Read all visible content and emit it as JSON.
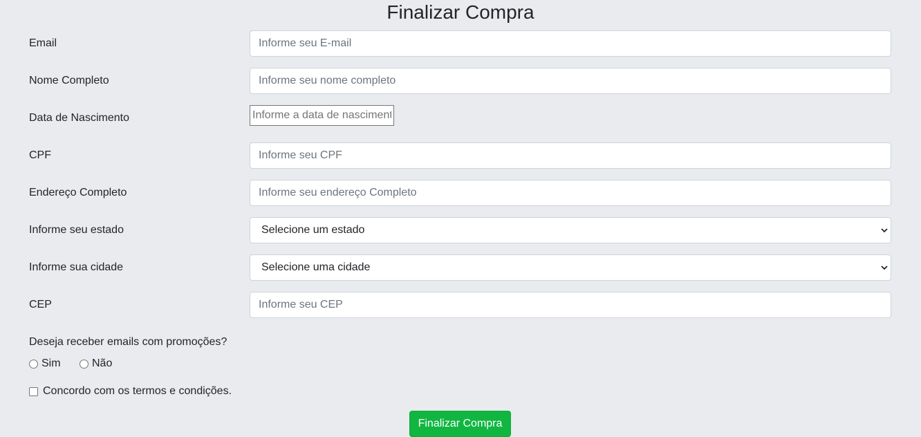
{
  "page": {
    "title": "Finalizar Compra"
  },
  "form": {
    "email": {
      "label": "Email",
      "placeholder": "Informe seu E-mail",
      "value": ""
    },
    "full_name": {
      "label": "Nome Completo",
      "placeholder": "Informe seu nome completo",
      "value": ""
    },
    "birth_date": {
      "label": "Data de Nascimento",
      "placeholder": "Informe a data de nascimento",
      "value": ""
    },
    "cpf": {
      "label": "CPF",
      "placeholder": "Informe seu CPF",
      "value": ""
    },
    "address": {
      "label": "Endereço Completo",
      "placeholder": "Informe seu endereço Completo",
      "value": ""
    },
    "state": {
      "label": "Informe seu estado",
      "selected": "Selecione um estado"
    },
    "city": {
      "label": "Informe sua cidade",
      "selected": "Selecione uma cidade"
    },
    "cep": {
      "label": "CEP",
      "placeholder": "Informe seu CEP",
      "value": ""
    },
    "promotions": {
      "question": "Deseja receber emails com promoções?",
      "options": [
        {
          "label": "Sim",
          "checked": false
        },
        {
          "label": "Não",
          "checked": false
        }
      ]
    },
    "terms": {
      "label": "Concordo com os termos e condições.",
      "checked": false
    },
    "submit_label": "Finalizar Compra"
  },
  "colors": {
    "background": "#e9ebee",
    "submit_button": "#11b641",
    "input_border": "#ced4da"
  },
  "icons": {
    "select_arrow": "chevron-down-icon"
  }
}
